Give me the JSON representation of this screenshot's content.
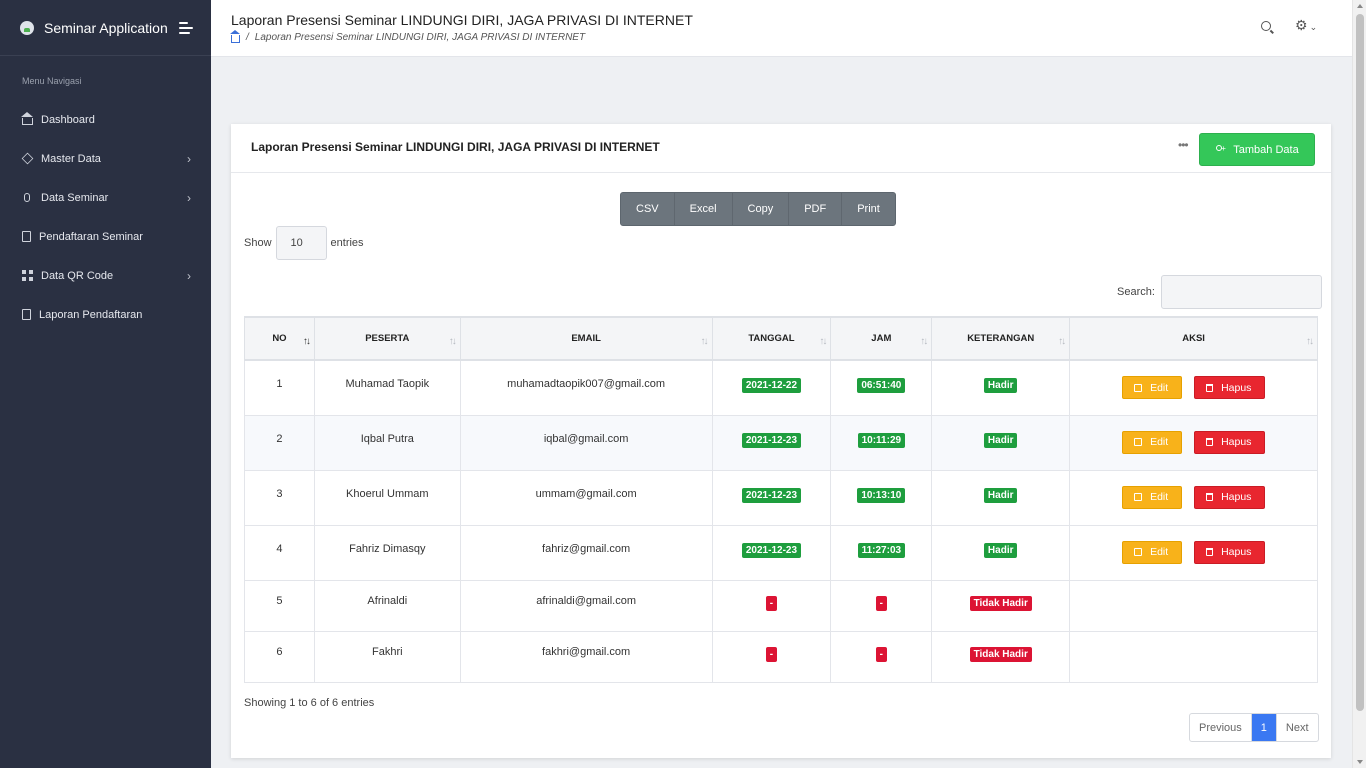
{
  "app": {
    "title": "Seminar Application"
  },
  "sidebar": {
    "menu_label": "Menu Navigasi",
    "items": [
      {
        "label": "Dashboard",
        "icon": "home-icon",
        "has_children": false
      },
      {
        "label": "Master Data",
        "icon": "layers-icon",
        "has_children": true
      },
      {
        "label": "Data Seminar",
        "icon": "mic-icon",
        "has_children": true
      },
      {
        "label": "Pendaftaran Seminar",
        "icon": "book-icon",
        "has_children": false
      },
      {
        "label": "Data QR Code",
        "icon": "grid-icon",
        "has_children": true
      },
      {
        "label": "Laporan Pendaftaran",
        "icon": "clipboard-icon",
        "has_children": false
      }
    ]
  },
  "header": {
    "title": "Laporan Presensi Seminar LINDUNGI DIRI, JAGA PRIVASI DI INTERNET",
    "breadcrumb": "Laporan Presensi Seminar LINDUNGI DIRI, JAGA PRIVASI DI INTERNET"
  },
  "card": {
    "title": "Laporan Presensi Seminar LINDUNGI DIRI, JAGA PRIVASI DI INTERNET",
    "more": "•••",
    "add_button": "Tambah Data"
  },
  "export_buttons": [
    "CSV",
    "Excel",
    "Copy",
    "PDF",
    "Print"
  ],
  "length": {
    "show": "Show",
    "value": "10",
    "entries": "entries"
  },
  "search": {
    "label": "Search:",
    "value": ""
  },
  "table": {
    "columns": [
      "NO",
      "PESERTA",
      "EMAIL",
      "TANGGAL",
      "JAM",
      "KETERANGAN",
      "AKSI"
    ],
    "rows": [
      {
        "no": "1",
        "peserta": "Muhamad Taopik",
        "email": "muhamadtaopik007@gmail.com",
        "tanggal": "2021-12-22",
        "jam": "06:51:40",
        "keterangan": "Hadir",
        "hadir": true
      },
      {
        "no": "2",
        "peserta": "Iqbal Putra",
        "email": "iqbal@gmail.com",
        "tanggal": "2021-12-23",
        "jam": "10:11:29",
        "keterangan": "Hadir",
        "hadir": true
      },
      {
        "no": "3",
        "peserta": "Khoerul Ummam",
        "email": "ummam@gmail.com",
        "tanggal": "2021-12-23",
        "jam": "10:13:10",
        "keterangan": "Hadir",
        "hadir": true
      },
      {
        "no": "4",
        "peserta": "Fahriz Dimasqy",
        "email": "fahriz@gmail.com",
        "tanggal": "2021-12-23",
        "jam": "11:27:03",
        "keterangan": "Hadir",
        "hadir": true
      },
      {
        "no": "5",
        "peserta": "Afrinaldi",
        "email": "afrinaldi@gmail.com",
        "tanggal": "-",
        "jam": "-",
        "keterangan": "Tidak Hadir",
        "hadir": false
      },
      {
        "no": "6",
        "peserta": "Fakhri",
        "email": "fakhri@gmail.com",
        "tanggal": "-",
        "jam": "-",
        "keterangan": "Tidak Hadir",
        "hadir": false
      }
    ],
    "edit_label": "Edit",
    "delete_label": "Hapus"
  },
  "footer": {
    "info": "Showing 1 to 6 of 6 entries",
    "previous": "Previous",
    "current_page": "1",
    "next": "Next"
  },
  "colors": {
    "sidebar_bg": "#2a3042",
    "success": "#1e9e3e",
    "danger": "#dc1434",
    "warning": "#f8b21a",
    "primary": "#3a78f2",
    "add_button": "#34c759"
  }
}
